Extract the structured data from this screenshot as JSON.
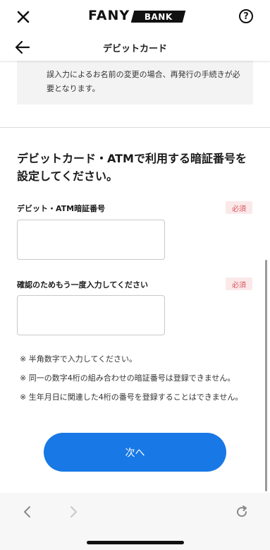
{
  "header": {
    "logo_primary": "FANY",
    "logo_secondary": "BANK",
    "help_label": "?"
  },
  "subheader": {
    "title": "デビットカード"
  },
  "notice": {
    "text": "誤入力によるお名前の変更の場合、再発行の手続きが必要となります。"
  },
  "form": {
    "heading": "デビットカード・ATMで利用する暗証番号を設定してください。",
    "pin_label": "デビット・ATM暗証番号",
    "pin_value": "",
    "confirm_label": "確認のためもう一度入力してください",
    "confirm_value": "",
    "required_label": "必須"
  },
  "notes": [
    "※ 半角数字で入力してください。",
    "※ 同一の数字4桁の組み合わせの暗証番号は登録できません。",
    "※ 生年月日に関連した4桁の番号を登録することはできません。"
  ],
  "actions": {
    "next_label": "次へ"
  },
  "colors": {
    "accent": "#1778e6",
    "required_text": "#d9535b",
    "required_bg": "#fbe9ea",
    "notice_bg": "#f3f3f3"
  },
  "icons": {
    "close": "close-icon",
    "help": "help-icon",
    "back": "arrow-left-icon",
    "browser_back": "chevron-left-icon",
    "browser_forward": "chevron-right-icon",
    "reload": "reload-icon"
  }
}
